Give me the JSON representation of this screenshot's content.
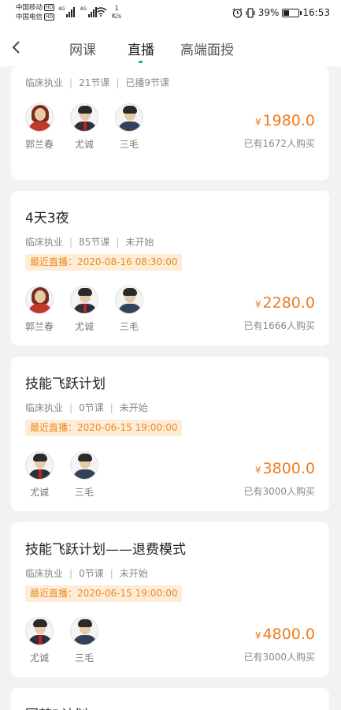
{
  "status": {
    "carrier1": "中国移动",
    "carrier2": "中国电信",
    "hd": "HD",
    "net_label": "4G",
    "speed_value": "1",
    "speed_unit": "K/s",
    "battery": "39%",
    "battery_level": 0.39,
    "time": "16:53"
  },
  "nav": {
    "tabs": [
      {
        "label": "网课"
      },
      {
        "label": "直播"
      },
      {
        "label": "高端面授"
      }
    ],
    "active_tab": "直播",
    "accent": "#1ab071"
  },
  "courses": [
    {
      "title": "",
      "category": "临床执业",
      "lessons": "21节课",
      "progress": "已播9节课",
      "live_time": "",
      "teachers": [
        {
          "name": "郭兰春",
          "avatar": "female"
        },
        {
          "name": "尤诚",
          "avatar": "male"
        },
        {
          "name": "三毛",
          "avatar": "male-blue"
        }
      ],
      "currency": "¥",
      "price": "1980.0",
      "buyers": "已有1672人购买"
    },
    {
      "title": "4天3夜",
      "category": "临床执业",
      "lessons": "85节课",
      "progress": "未开始",
      "live_label": "最近直播：",
      "live_time": "2020-08-16 08:30:00",
      "teachers": [
        {
          "name": "郭兰春",
          "avatar": "female"
        },
        {
          "name": "尤诚",
          "avatar": "male"
        },
        {
          "name": "三毛",
          "avatar": "male-blue"
        }
      ],
      "currency": "¥",
      "price": "2280.0",
      "buyers": "已有1666人购买"
    },
    {
      "title": "技能飞跃计划",
      "category": "临床执业",
      "lessons": "0节课",
      "progress": "未开始",
      "live_label": "最近直播：",
      "live_time": "2020-06-15 19:00:00",
      "teachers": [
        {
          "name": "尤诚",
          "avatar": "male"
        },
        {
          "name": "三毛",
          "avatar": "male-blue"
        }
      ],
      "currency": "¥",
      "price": "3800.0",
      "buyers": "已有3000人购买"
    },
    {
      "title": "技能飞跃计划——退费模式",
      "category": "临床执业",
      "lessons": "0节课",
      "progress": "未开始",
      "live_label": "最近直播：",
      "live_time": "2020-06-15 19:00:00",
      "teachers": [
        {
          "name": "尤诚",
          "avatar": "male"
        },
        {
          "name": "三毛",
          "avatar": "male-blue"
        }
      ],
      "currency": "¥",
      "price": "4800.0",
      "buyers": "已有3000人购买"
    },
    {
      "title": "圆梦B计划"
    }
  ],
  "colors": {
    "price": "#ee7b1d",
    "live_tag_bg": "#fdecd8",
    "live_tag_text": "#ee8a1d",
    "page_bg": "#f2f2f2"
  },
  "separator": "|"
}
